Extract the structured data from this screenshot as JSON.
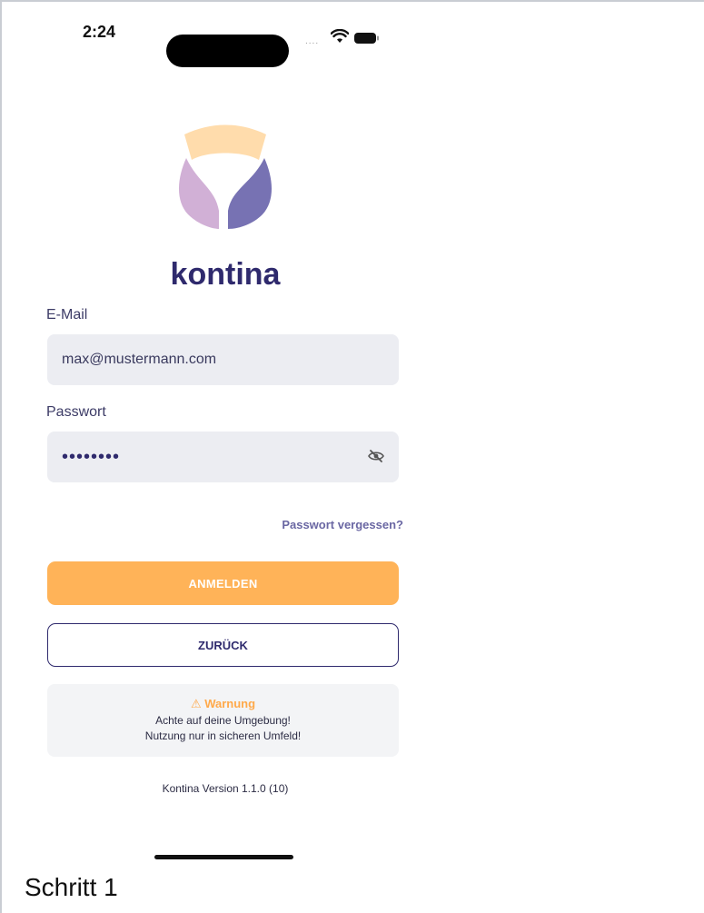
{
  "status_bar": {
    "time": "2:24",
    "signal": "....",
    "icons": [
      "wifi-icon",
      "battery-icon"
    ]
  },
  "brand": {
    "name": "kontina",
    "logo_icon": "kontina-logo-icon"
  },
  "form": {
    "email_label": "E-Mail",
    "email_value": "max@mustermann.com",
    "password_label": "Passwort",
    "password_value": "••••••••",
    "password_toggle_icon": "eye-off-icon",
    "forgot_link": "Passwort vergessen?"
  },
  "buttons": {
    "login": "ANMELDEN",
    "back": "ZURÜCK"
  },
  "warning": {
    "title": "⚠ Warnung",
    "line1": "Achte auf deine Umgebung!",
    "line2": "Nutzung nur in sicheren Umfeld!"
  },
  "version": "Kontina Version 1.1.0 (10)",
  "caption": "Schritt 1",
  "colors": {
    "primary": "#ffb358",
    "brand_dark": "#2f2a6d",
    "logo_peach": "#ffdcac",
    "logo_lilac": "#d1b0d6",
    "logo_purple": "#7772b3",
    "warning": "#ffa94a",
    "input_bg": "#ecedf2"
  }
}
